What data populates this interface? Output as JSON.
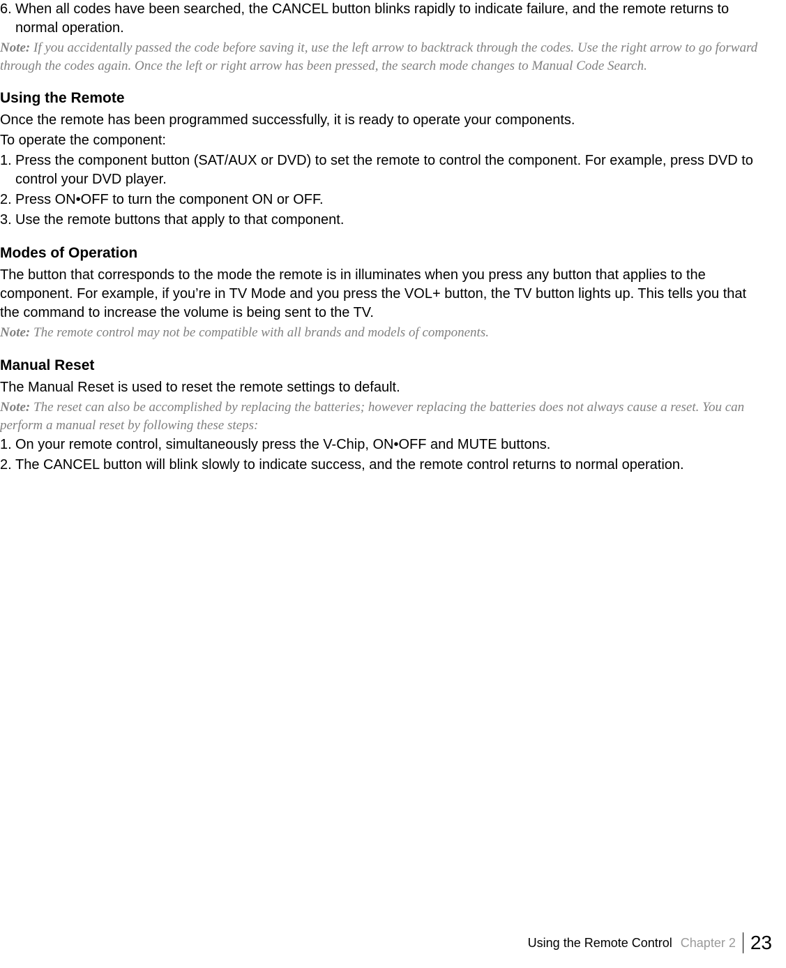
{
  "top": {
    "item6_num": "6.",
    "item6_text": "When all codes have been searched, the CANCEL button blinks rapidly to indicate failure, and the remote returns to normal operation.",
    "note_label": "Note:",
    "note_text": " If you accidentally passed the code before saving it, use the left arrow to backtrack through the codes. Use the right arrow to go forward through the codes again. Once the left or right arrow has been pressed, the search mode changes to Manual Code Search."
  },
  "using_remote": {
    "heading": "Using the Remote",
    "p1": "Once the remote has been programmed successfully, it is ready to operate your components.",
    "p2": "To operate the component:",
    "li1_num": "1.",
    "li1_text": "Press the component button (SAT/AUX or DVD) to set the remote to control the component. For example, press DVD to control your DVD player.",
    "li2_num": "2.",
    "li2_text": "Press ON•OFF to turn the component ON or OFF.",
    "li3_num": "3.",
    "li3_text": "Use the remote buttons that apply to that component."
  },
  "modes": {
    "heading": "Modes of Operation",
    "p1": "The button that corresponds to the mode the remote is in illuminates when you press any button that applies to the component. For example, if you’re in TV Mode and you press the VOL+ button, the TV button lights up. This tells you that the command to increase the volume is being sent to the TV.",
    "note_label": "Note:",
    "note_text": " The remote control may not be compatible with all brands and models of components."
  },
  "manual_reset": {
    "heading": "Manual Reset",
    "p1": "The Manual Reset is used to reset the remote settings to default.",
    "note_label": "Note:",
    "note_text": " The reset can also be accomplished by replacing the batteries; however replacing the batteries does not always cause a reset. You can perform a manual reset by following these steps:",
    "li1_num": "1.",
    "li1_text": "On your remote control, simultaneously press the V-Chip, ON•OFF and MUTE buttons.",
    "li2_num": "2.",
    "li2_text": "The CANCEL button will blink slowly to indicate success, and the remote control returns to normal operation."
  },
  "footer": {
    "section": "Using the Remote Control",
    "chapter": "Chapter 2",
    "page": "23"
  }
}
